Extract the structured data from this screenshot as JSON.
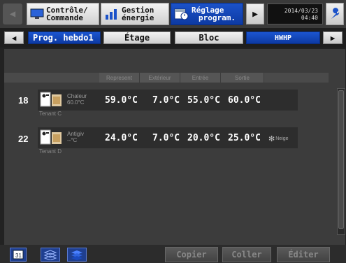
{
  "topbar": {
    "controle": [
      "Contrôle/",
      "Commande"
    ],
    "gestion": [
      "Gestion",
      "énergie"
    ],
    "reglage": [
      "Réglage",
      "program."
    ],
    "date": "2014/03/23",
    "time": "04:40"
  },
  "tabs": {
    "prog": "Prog. hebdo1",
    "etage": "Étage",
    "bloc": "Bloc",
    "hwhp": "HWHP"
  },
  "columns": [
    "Represent",
    "Extérieur",
    "Entrée",
    "Sortie"
  ],
  "rows": [
    {
      "num": "18",
      "mode": "Chaleur",
      "setpoint": "60.0°C",
      "represent": "59.0°C",
      "exterieur": "7.0°C",
      "entree": "55.0°C",
      "sortie": "60.0°C",
      "tenant": "Tenant C",
      "extra": ""
    },
    {
      "num": "22",
      "mode": "Antigiv",
      "setpoint": "--°C",
      "represent": "24.0°C",
      "exterieur": "7.0°C",
      "entree": "20.0°C",
      "sortie": "25.0°C",
      "tenant": "Tenant D",
      "extra": "Neige"
    }
  ],
  "bottom": {
    "copier": "Copier",
    "coller": "Coller",
    "editer": "Éditer"
  },
  "colors": {
    "accent_blue": "#1b52c9",
    "background": "#3c3c3c"
  }
}
